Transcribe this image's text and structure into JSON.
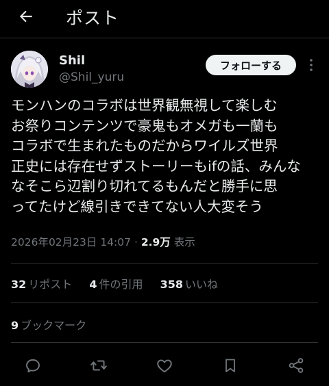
{
  "header": {
    "title": "ポスト",
    "back_icon": "arrow-left-icon"
  },
  "author": {
    "display_name": "Shil",
    "handle": "@Shil_yuru",
    "follow_label": "フォローする",
    "more_icon": "more-vertical-icon"
  },
  "tweet": {
    "lines": [
      "モンハンのコラボは世界観無視して楽しむ",
      "お祭りコンテンツで豪鬼もオメガも一蘭も",
      "コラボで生まれたものだからワイルズ世界",
      "正史には存在せずストーリーもifの話、みんな",
      "なそこら辺割り切れてるもんだと勝手に思",
      "ってたけど線引きできてない人大変そう"
    ]
  },
  "meta": {
    "timestamp": "2026年02月23日 14:07",
    "separator": "·",
    "views_count": "2.9万",
    "views_label": "表示"
  },
  "stats": {
    "reposts_count": "32",
    "reposts_label": "リポスト",
    "quotes_count": "4",
    "quotes_label": "件の引用",
    "likes_count": "358",
    "likes_label": "いいね",
    "bookmarks_count": "9",
    "bookmarks_label": "ブックマーク"
  },
  "actions": {
    "icons": [
      "reply-icon",
      "repost-icon",
      "like-icon",
      "bookmark-icon",
      "share-icon"
    ]
  },
  "colors": {
    "background": "#000000",
    "text": "#e7e9ea",
    "muted": "#71767b",
    "divider": "#2f3336",
    "follow_bg": "#eff3f4"
  }
}
